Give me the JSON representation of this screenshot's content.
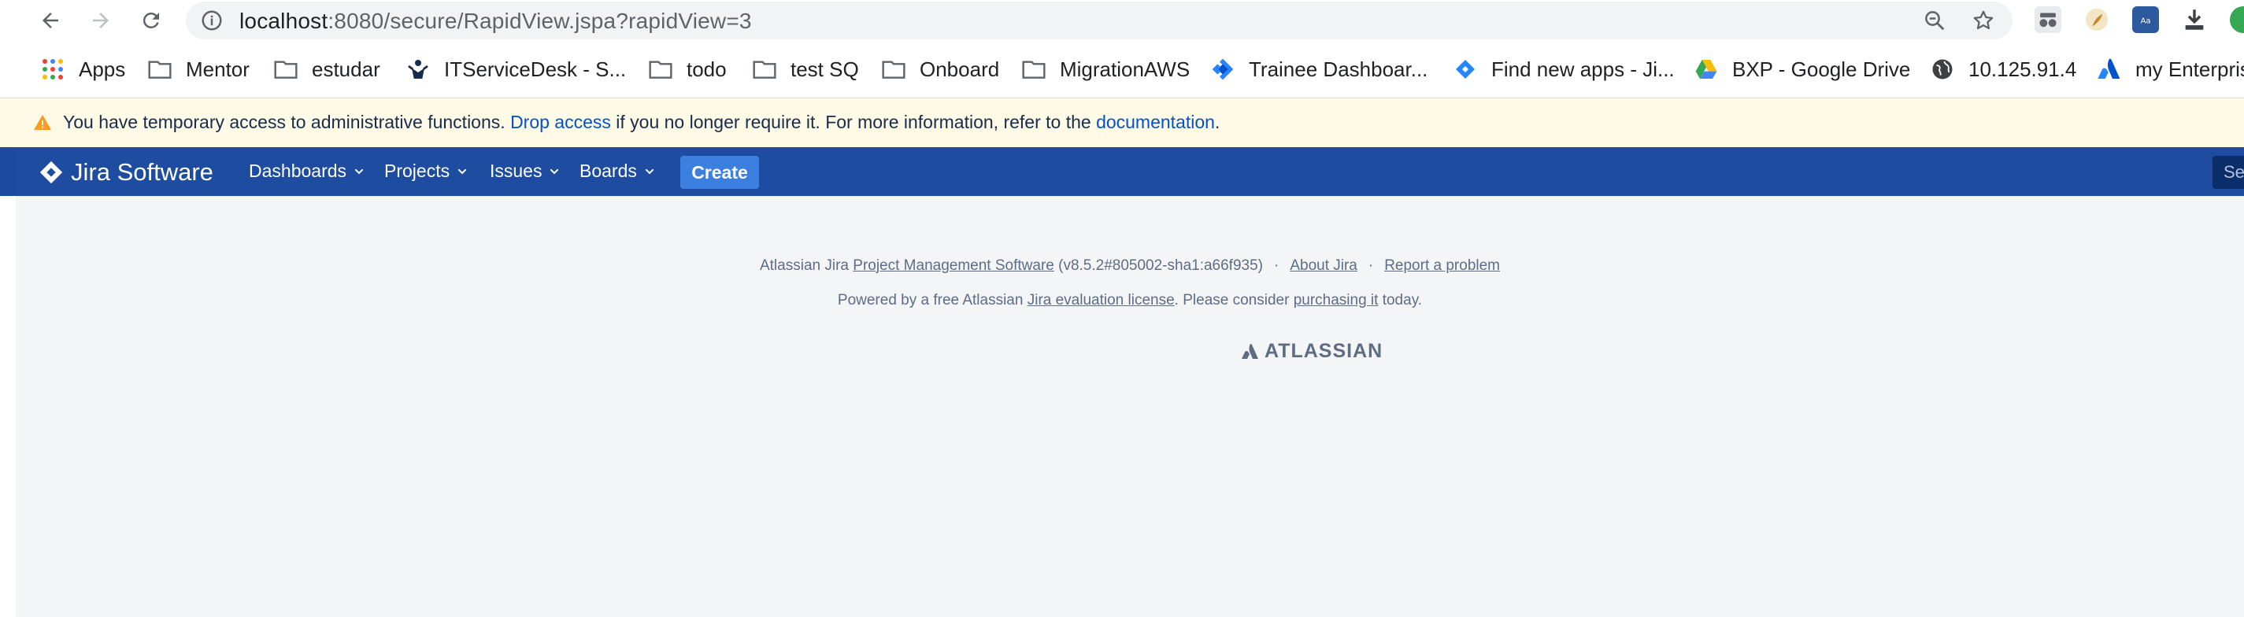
{
  "browser": {
    "url_host": "localhost",
    "url_path": ":8080/secure/RapidView.jspa?rapidView=3",
    "bookmarks": [
      {
        "label": "Apps",
        "icon": "apps-grid-icon"
      },
      {
        "label": "Mentor",
        "icon": "folder-icon"
      },
      {
        "label": "estudar",
        "icon": "folder-icon"
      },
      {
        "label": "ITServiceDesk - S...",
        "icon": "servicedesk-icon"
      },
      {
        "label": "todo",
        "icon": "folder-icon"
      },
      {
        "label": "test SQ",
        "icon": "folder-icon"
      },
      {
        "label": "Onboard",
        "icon": "folder-icon"
      },
      {
        "label": "MigrationAWS",
        "icon": "folder-icon"
      },
      {
        "label": "Trainee Dashboar...",
        "icon": "jira-icon"
      },
      {
        "label": "Find new apps - Ji...",
        "icon": "marketplace-icon"
      },
      {
        "label": "BXP - Google Drive",
        "icon": "google-drive-icon"
      },
      {
        "label": "10.125.91.4",
        "icon": "globe-icon"
      },
      {
        "label": "my Enterpris",
        "icon": "atlassian-icon"
      }
    ]
  },
  "banner": {
    "text_before": "You have temporary access to administrative functions. ",
    "drop_access": "Drop access",
    "text_middle": " if you no longer require it. For more information, refer to the ",
    "documentation": "documentation",
    "text_after": "."
  },
  "header": {
    "logo_text": "Jira Software",
    "menus": [
      "Dashboards",
      "Projects",
      "Issues",
      "Boards"
    ],
    "create_label": "Create",
    "search_stub": "Se"
  },
  "footer": {
    "line1_prefix": "Atlassian Jira ",
    "line1_link": "Project Management Software",
    "line1_version": " (v8.5.2#805002-sha1:a66f935)",
    "sep": "·",
    "about": "About Jira",
    "report": "Report a problem",
    "line2_prefix": "Powered by a free Atlassian ",
    "line2_link1": "Jira evaluation license",
    "line2_middle": ". Please consider ",
    "line2_link2": "purchasing it",
    "line2_suffix": " today.",
    "brand": "ATLASSIAN"
  },
  "colors": {
    "jira_header": "#1e4ca1",
    "create_button": "#3b7fe0",
    "banner_bg": "#fffae6",
    "link": "#0052cc"
  }
}
